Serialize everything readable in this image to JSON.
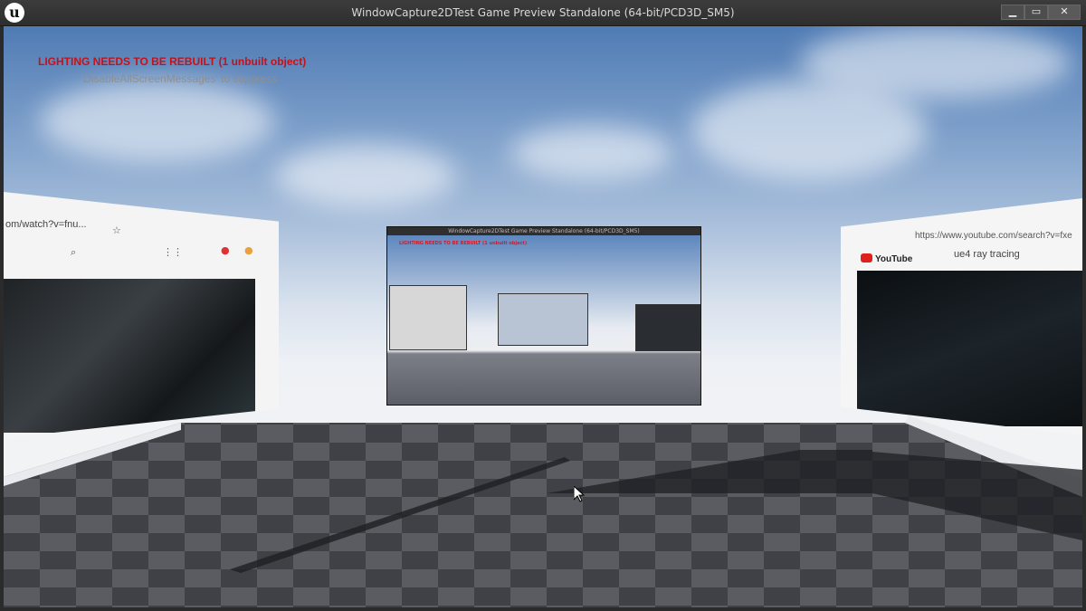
{
  "window": {
    "title": "WindowCapture2DTest Game Preview Standalone (64-bit/PCD3D_SM5)",
    "logo_glyph": "u",
    "controls": {
      "minimize": "▁",
      "maximize": "▭",
      "close": "✕"
    }
  },
  "messages": {
    "lighting": "LIGHTING NEEDS TO BE REBUILT (1 unbuilt object)",
    "suppress": "'DisableAllScreenMessages' to suppress"
  },
  "left_panel": {
    "url_fragment": "om/watch?v=fnu..."
  },
  "center_panel": {
    "title": "WindowCapture2DTest Game Preview Standalone (64-bit/PCD3D_SM5)"
  },
  "right_panel": {
    "url": "https://www.youtube.com/search?v=fxe",
    "brand": "YouTube",
    "search_text": "ue4 ray tracing"
  },
  "colors": {
    "warning_text": "#c4121a",
    "hint_text": "#8f8f8f",
    "floor_light": "#5b5d63",
    "floor_dark": "#3d3f45"
  }
}
